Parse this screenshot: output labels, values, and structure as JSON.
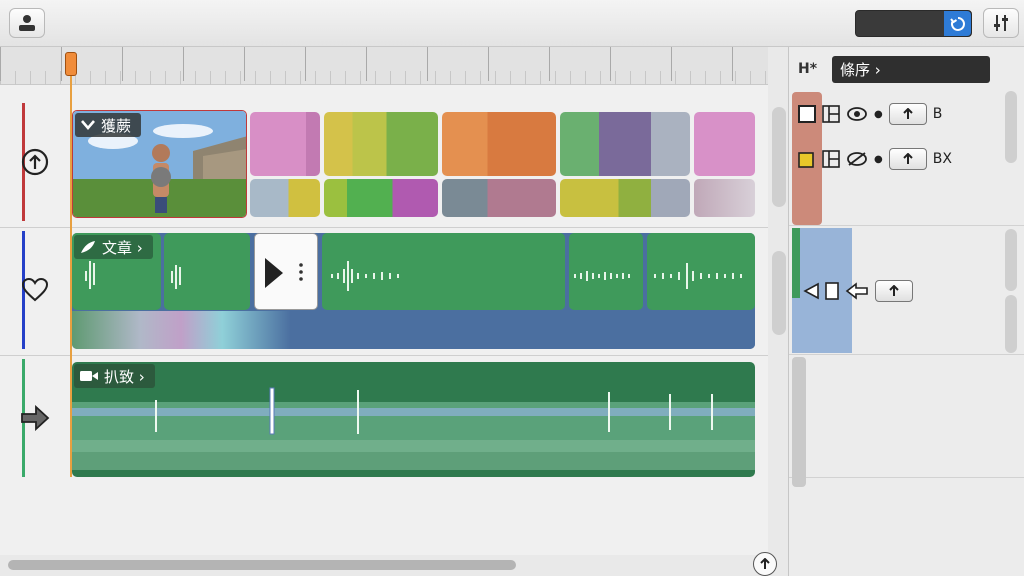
{
  "toolbar": {
    "user_icon": "user-icon",
    "mix_icon": "sliders-icon",
    "search_icon": "refresh-icon"
  },
  "ruler": {
    "playhead_icon": "playhead-knob"
  },
  "tracks": [
    {
      "label": "獲蕨",
      "icon": "up-circle-icon",
      "accent": "#c0393b",
      "clip_color": "#7aa7d8"
    },
    {
      "label": "文章 ›",
      "icon": "heart-icon",
      "accent": "#2540c8",
      "clip_color": "#3f9a5b"
    },
    {
      "label": "扒致 ›",
      "icon": "right-arrow-icon",
      "accent": "#3aaa6a",
      "clip_color": "#2f7a4e"
    }
  ],
  "inspector": {
    "header_glyph": "H*",
    "title": "條序 ›",
    "rows": [
      {
        "trail": "B"
      },
      {
        "trail": "BX"
      }
    ]
  },
  "colors": {
    "accent_blue": "#2e7bd6",
    "playhead": "#f08c3a",
    "clip_green": "#3f9a5b"
  }
}
